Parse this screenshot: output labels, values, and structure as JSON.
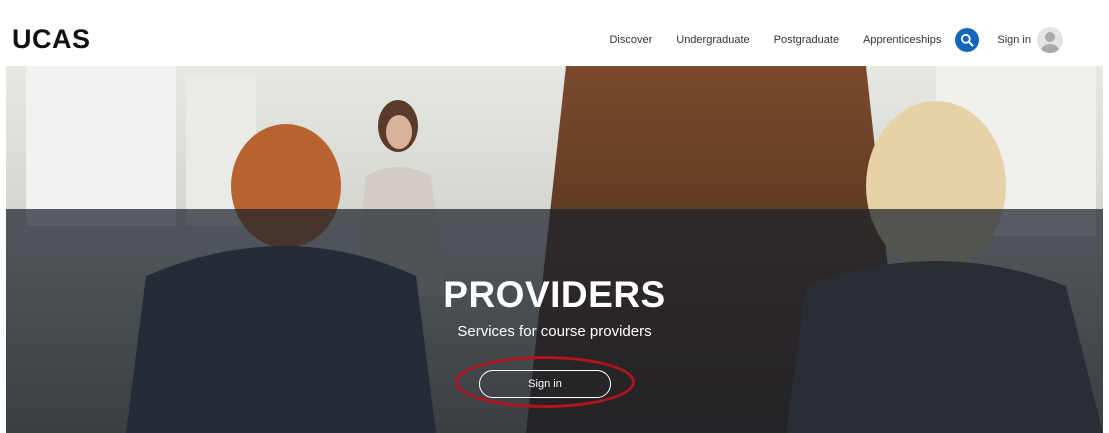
{
  "header": {
    "logo": "UCAS",
    "nav": [
      {
        "label": "Discover"
      },
      {
        "label": "Undergraduate"
      },
      {
        "label": "Postgraduate"
      },
      {
        "label": "Apprenticeships"
      }
    ],
    "search_icon": "search-icon",
    "signin_label": "Sign in",
    "avatar_icon": "user-avatar-icon"
  },
  "hero": {
    "title": "PROVIDERS",
    "subtitle": "Services for course providers",
    "button_label": "Sign in"
  },
  "colors": {
    "accent": "#1565c0",
    "highlight_ring": "#b3131e",
    "band": "#1c232d"
  }
}
